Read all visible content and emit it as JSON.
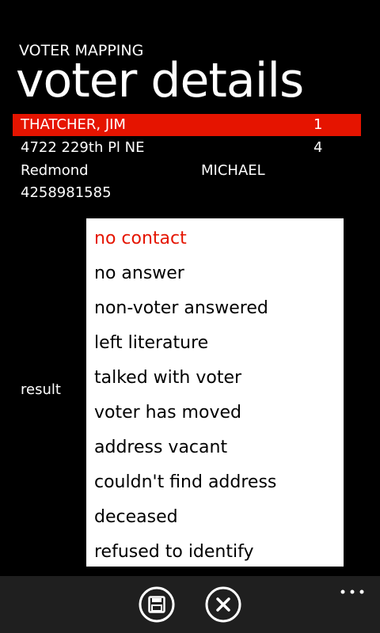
{
  "header": {
    "app_title": "VOTER MAPPING",
    "page_title": "voter details"
  },
  "voter": {
    "rows": [
      {
        "col_a": "THATCHER, JIM",
        "col_b": "",
        "col_c": "1"
      },
      {
        "col_a": "4722 229th Pl NE",
        "col_b": "",
        "col_c": "4"
      },
      {
        "col_a": "Redmond",
        "col_b": "MICHAEL",
        "col_c": ""
      },
      {
        "col_a": "4258981585",
        "col_b": "",
        "col_c": ""
      }
    ]
  },
  "result": {
    "label": "result",
    "selected": "no contact",
    "options": [
      "no contact",
      "no answer",
      "non-voter answered",
      "left literature",
      "talked with voter",
      "voter has moved",
      "address vacant",
      "couldn't find address",
      "deceased",
      "refused to identify"
    ]
  },
  "app_bar": {
    "buttons": [
      {
        "icon": "save-icon"
      },
      {
        "icon": "close-icon"
      }
    ],
    "more_icon": "ellipsis-icon"
  },
  "colors": {
    "accent": "#e51400",
    "background": "#000000",
    "app_bar": "#1f1f1f",
    "picker_bg": "#ffffff"
  }
}
